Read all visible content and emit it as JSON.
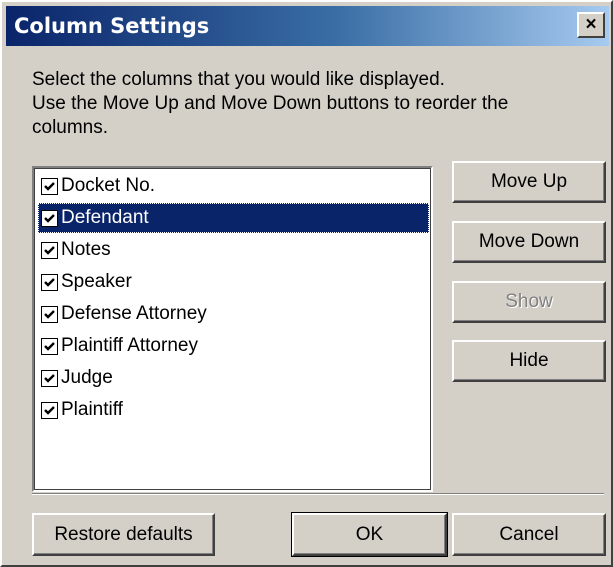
{
  "window": {
    "title": "Column Settings",
    "close_label": "×"
  },
  "instructions": {
    "line1": "Select the columns that you would like displayed.",
    "line2": "Use the Move Up and Move Down buttons to reorder the",
    "line3": "columns."
  },
  "columns_list": {
    "items": [
      {
        "label": "Docket No.",
        "checked": true,
        "selected": false
      },
      {
        "label": "Defendant",
        "checked": true,
        "selected": true
      },
      {
        "label": "Notes",
        "checked": true,
        "selected": false
      },
      {
        "label": "Speaker",
        "checked": true,
        "selected": false
      },
      {
        "label": "Defense Attorney",
        "checked": true,
        "selected": false
      },
      {
        "label": "Plaintiff Attorney",
        "checked": true,
        "selected": false
      },
      {
        "label": "Judge",
        "checked": true,
        "selected": false
      },
      {
        "label": "Plaintiff",
        "checked": true,
        "selected": false
      }
    ]
  },
  "side_buttons": {
    "move_up": "Move Up",
    "move_down": "Move Down",
    "show": "Show",
    "show_enabled": false,
    "hide": "Hide"
  },
  "footer_buttons": {
    "restore_defaults": "Restore defaults",
    "ok": "OK",
    "cancel": "Cancel"
  },
  "colors": {
    "selection": "#0a246a",
    "title_gradient_start": "#0a246a",
    "title_gradient_end": "#a6caf0",
    "face": "#d4d0c8"
  }
}
